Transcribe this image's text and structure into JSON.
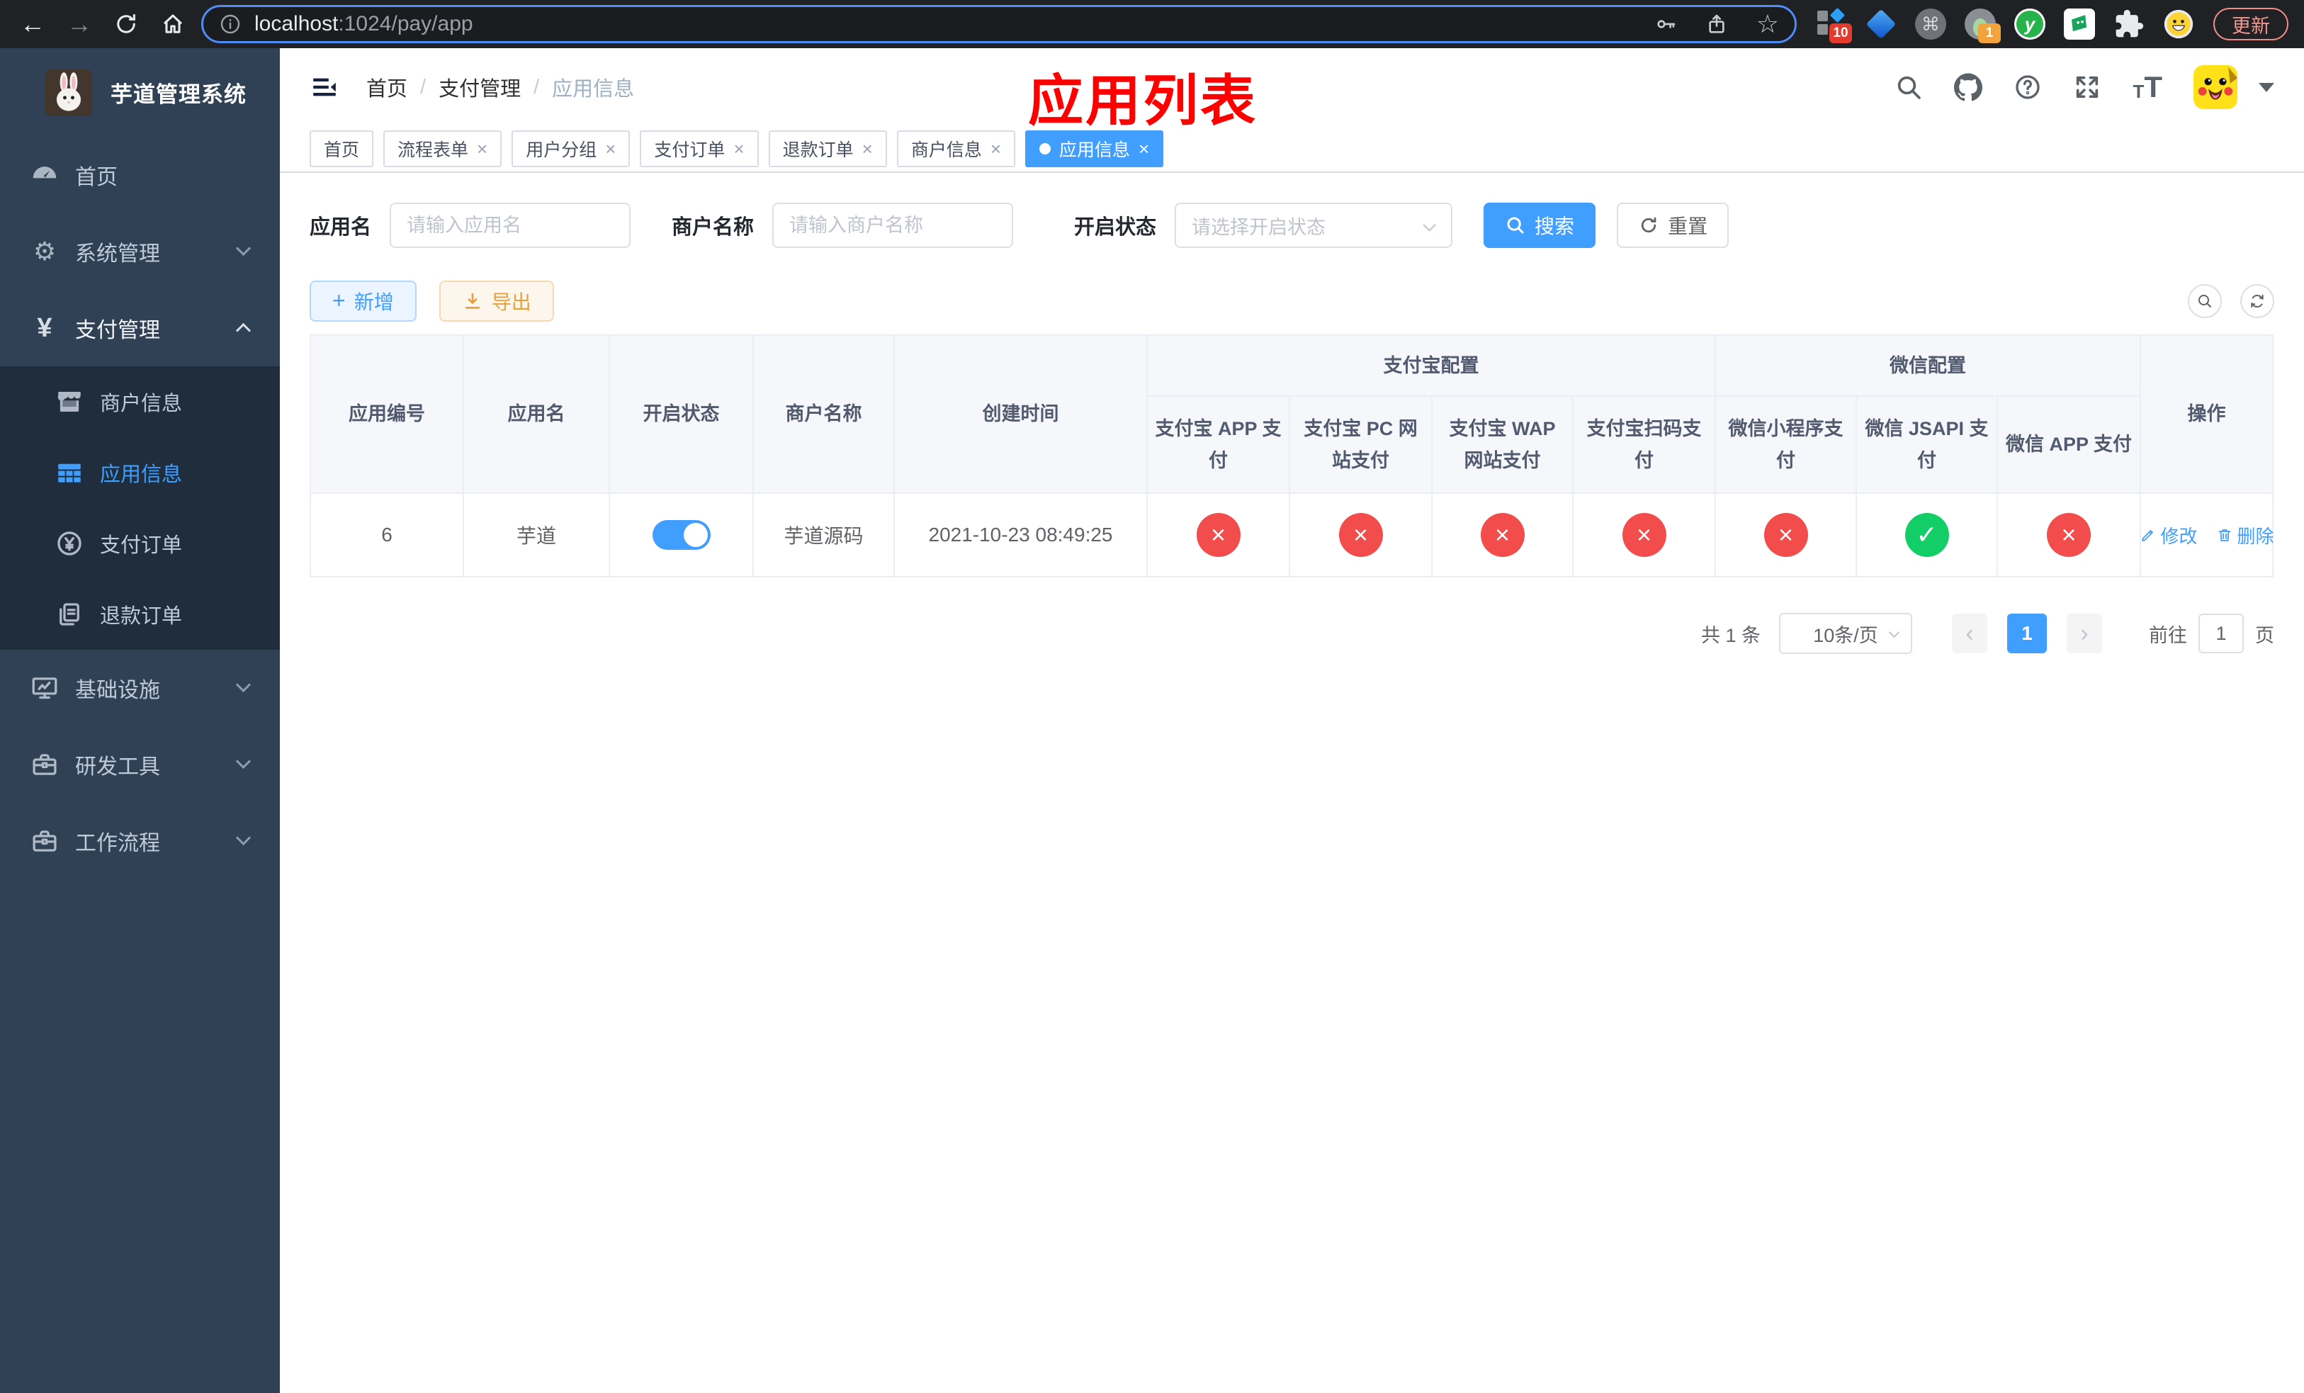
{
  "browser": {
    "url_host": "localhost",
    "url_rest": ":1024/pay/app",
    "update_label": "更新",
    "ext_blocks_badge": "10",
    "ext_avatar_badge": "1",
    "ext_y_letter": "y"
  },
  "icons": {
    "back": "←",
    "forward": "→",
    "kebab": "⋮",
    "star": "☆",
    "command": "⌘",
    "gear": "⚙",
    "yen": "¥",
    "close_tab": "×",
    "plus": "+",
    "pager_prev": "‹",
    "pager_next": "›",
    "text_size_small": "T",
    "text_size_large": "T"
  },
  "sidebar": {
    "title": "芋道管理系统",
    "home": "首页",
    "system": "系统管理",
    "pay": "支付管理",
    "sub_merchant": "商户信息",
    "sub_app": "应用信息",
    "sub_order": "支付订单",
    "sub_refund": "退款订单",
    "infra": "基础设施",
    "devtool": "研发工具",
    "workflow": "工作流程"
  },
  "topbar": {
    "breadcrumb_1": "首页",
    "breadcrumb_2": "支付管理",
    "breadcrumb_3": "应用信息",
    "separator": "/",
    "annotation": "应用列表"
  },
  "tabs": [
    {
      "label": "首页"
    },
    {
      "label": "流程表单"
    },
    {
      "label": "用户分组"
    },
    {
      "label": "支付订单"
    },
    {
      "label": "退款订单"
    },
    {
      "label": "商户信息"
    },
    {
      "label": "应用信息"
    }
  ],
  "filters": {
    "app_name_label": "应用名",
    "app_name_placeholder": "请输入应用名",
    "merchant_label": "商户名称",
    "merchant_placeholder": "请输入商户名称",
    "status_label": "开启状态",
    "status_placeholder": "请选择开启状态",
    "search_label": "搜索",
    "reset_label": "重置"
  },
  "toolbar": {
    "add_label": "新增",
    "export_label": "导出"
  },
  "table": {
    "col_id": "应用编号",
    "col_name": "应用名",
    "col_status": "开启状态",
    "col_merchant": "商户名称",
    "col_created": "创建时间",
    "group_alipay": "支付宝配置",
    "group_wechat": "微信配置",
    "col_alipay_app": "支付宝 APP 支付",
    "col_alipay_pc": "支付宝 PC 网站支付",
    "col_alipay_wap": "支付宝 WAP 网站支付",
    "col_alipay_qr": "支付宝扫码支付",
    "col_wx_mini": "微信小程序支付",
    "col_wx_jsapi": "微信 JSAPI 支付",
    "col_wx_app": "微信 APP 支付",
    "col_actions": "操作",
    "row": {
      "id": "6",
      "name": "芋道",
      "enabled": true,
      "merchant": "芋道源码",
      "created": "2021-10-23 08:49:25",
      "statuses": [
        false,
        false,
        false,
        false,
        false,
        true,
        false
      ],
      "status_ok_glyph": "✓",
      "status_no_glyph": "×",
      "edit_label": "修改",
      "delete_label": "删除"
    }
  },
  "pagination": {
    "total": "共 1 条",
    "page_size": "10条/页",
    "page": "1",
    "goto_prefix": "前往",
    "goto_value": "1",
    "goto_suffix": "页"
  },
  "colors": {
    "accent": "#409eff",
    "success": "#13ce66",
    "danger": "#f24c4c",
    "warning": "#e6a23c",
    "sidebar_bg": "#304156",
    "submenu_bg": "#1f2d3d",
    "annotation_red": "#fd0100"
  }
}
